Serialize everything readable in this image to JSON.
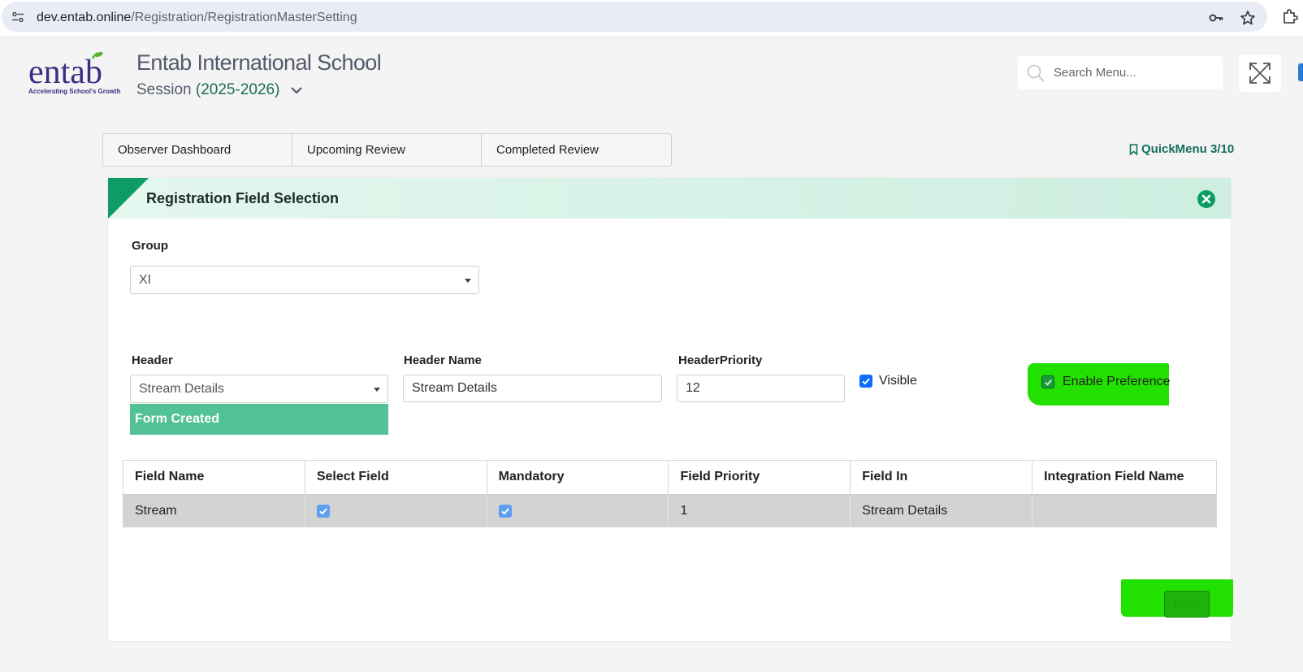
{
  "browser": {
    "url_domain": "dev.entab.online",
    "url_path": "/Registration/RegistrationMasterSetting"
  },
  "header": {
    "logo_text": "entab",
    "logo_tagline": "Accelerating School's Growth",
    "school_name": "Entab International School",
    "session_label": "Session",
    "session_value": "(2025-2026)",
    "search_placeholder": "Search Menu..."
  },
  "tabs": [
    {
      "label": "Observer Dashboard"
    },
    {
      "label": "Upcoming Review"
    },
    {
      "label": "Completed Review"
    }
  ],
  "quickmenu": {
    "label": "QuickMenu 3/10"
  },
  "panel": {
    "title": "Registration Field Selection",
    "group": {
      "label": "Group",
      "value": "XI"
    },
    "header_field": {
      "label": "Header",
      "value": "Stream Details",
      "dropdown_option": "Form Created"
    },
    "header_name": {
      "label": "Header Name",
      "value": "Stream Details"
    },
    "header_priority": {
      "label": "HeaderPriority",
      "value": "12"
    },
    "visible": {
      "label": "Visible",
      "checked": true
    },
    "enable_preference": {
      "label": "Enable Preference",
      "checked": true
    },
    "table": {
      "columns": [
        "Field Name",
        "Select Field",
        "Mandatory",
        "Field Priority",
        "Field In",
        "Integration Field Name"
      ],
      "rows": [
        {
          "field_name": "Stream",
          "select_field": true,
          "mandatory": true,
          "field_priority": "1",
          "field_in": "Stream Details",
          "integration_field_name": ""
        }
      ]
    },
    "save_label": "Save"
  },
  "colors": {
    "accent_green": "#0e9c66",
    "highlight": "#22e000",
    "dropdown_green": "#52c195",
    "checkbox_blue": "#0d6efd"
  }
}
